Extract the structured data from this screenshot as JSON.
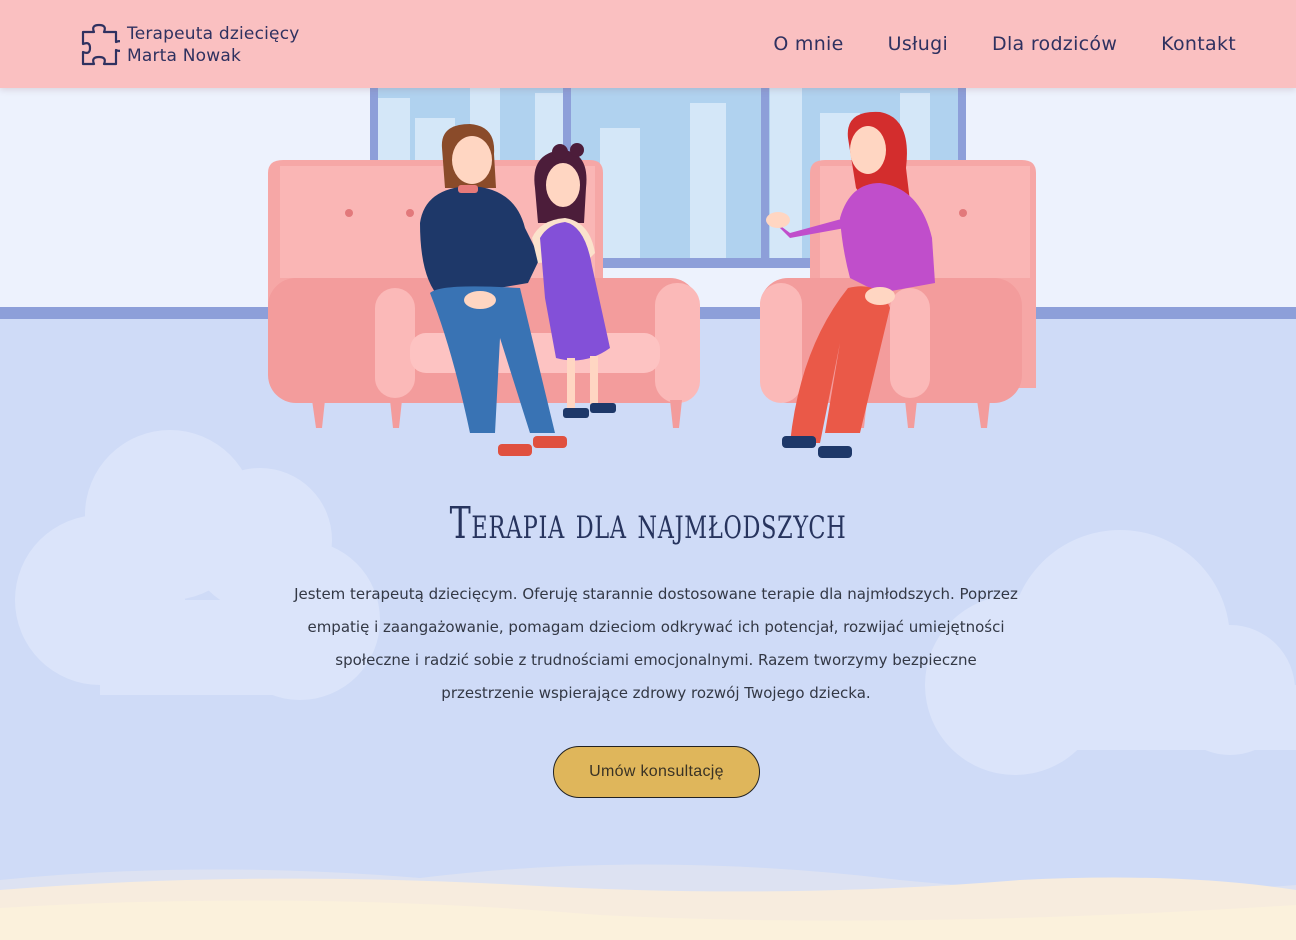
{
  "header": {
    "logo": {
      "icon": "puzzle-icon",
      "line1": "Terapeuta dziecięcy",
      "line2": "Marta Nowak"
    },
    "nav": [
      {
        "label": "O mnie"
      },
      {
        "label": "Usługi"
      },
      {
        "label": "Dla rodziców"
      },
      {
        "label": "Kontakt"
      }
    ]
  },
  "hero": {
    "title": "Terapia dla najmłodszych",
    "description": "Jestem terapeutą dziecięcym. Oferuję starannie dostosowane terapie dla najmłodszych. Poprzez empatię i zaangażowanie, pomagam dzieciom odkrywać ich potencjał, rozwijać umiejętności społeczne i radzić sobie z trudnościami emocjonalnymi. Razem tworzymy bezpieczne przestrzenie wspierające zdrowy rozwój Twojego dziecka.",
    "cta_label": "Umów konsultację"
  },
  "colors": {
    "header_bg": "#fac0c1",
    "navy": "#2f3160",
    "floor": "#cfdbf7",
    "wall": "#edf2fd",
    "cta": "#dfb65b",
    "sand": "#fbf1dc"
  }
}
